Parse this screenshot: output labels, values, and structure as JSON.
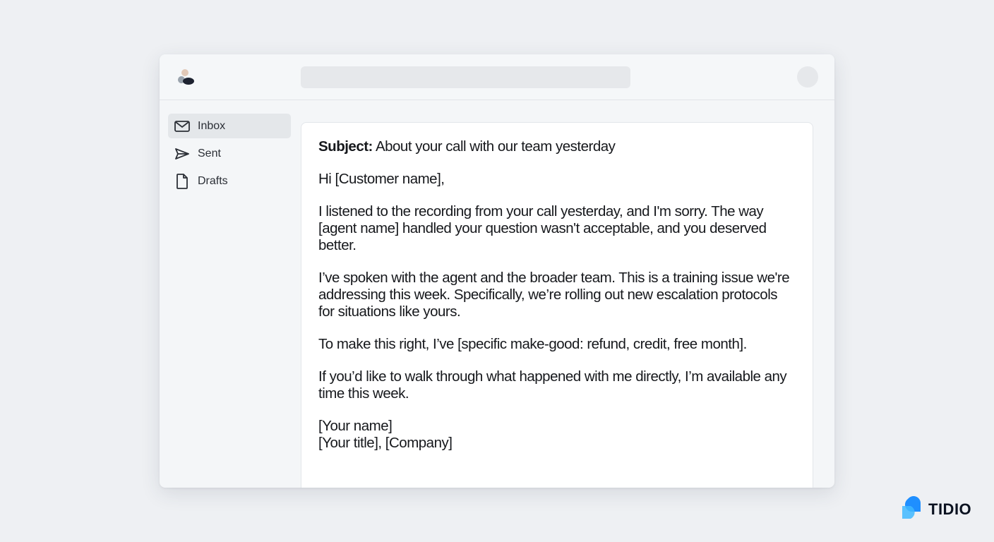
{
  "email": {
    "subject_label": "Subject:",
    "subject_text": "About your call with our team yesterday",
    "greeting": "Hi [Customer name],",
    "paragraph_1": "I listened to the recording from your call yesterday, and I'm sorry. The way [agent name] handled your question wasn't acceptable, and you deserved better.",
    "paragraph_2": "I’ve spoken with the agent and the broader team. This is a training issue we're addressing this week. Specifically, we’re rolling out new escalation protocols for situations like yours.",
    "paragraph_3": "To make this right, I’ve [specific make-good: refund, credit, free month].",
    "paragraph_4": "If you’d like to walk through what happened with me directly, I’m available any time this week.",
    "signature_name": "[Your name]",
    "signature_title": "[Your title], [Company]"
  },
  "sidebar": {
    "items": [
      {
        "label": "Inbox",
        "icon": "mail-icon",
        "active": true
      },
      {
        "label": "Sent",
        "icon": "send-icon",
        "active": false
      },
      {
        "label": "Drafts",
        "icon": "document-icon",
        "active": false
      }
    ]
  },
  "brand": {
    "name": "TIDIO",
    "accent": "#1f8fff"
  }
}
